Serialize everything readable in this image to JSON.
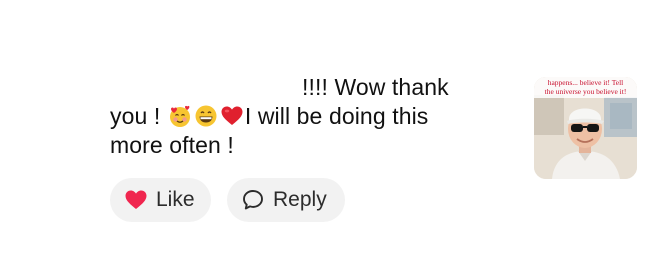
{
  "comment": {
    "line1": "!!!! Wow thank",
    "line2_prefix": "you ! ",
    "line2_suffix": "I will be doing this",
    "line3": "more often !",
    "emojis": [
      "smiling-face-with-hearts-emoji",
      "grinning-face-emoji",
      "red-heart-emoji"
    ]
  },
  "actions": {
    "like_label": "Like",
    "reply_label": "Reply"
  },
  "thumbnail": {
    "caption_line1": "happens... believe it! Tell",
    "caption_line2": "the universe you believe it!"
  },
  "colors": {
    "like_heart": "#f0264f",
    "pill_bg": "#f2f2f2",
    "text": "#111111"
  }
}
